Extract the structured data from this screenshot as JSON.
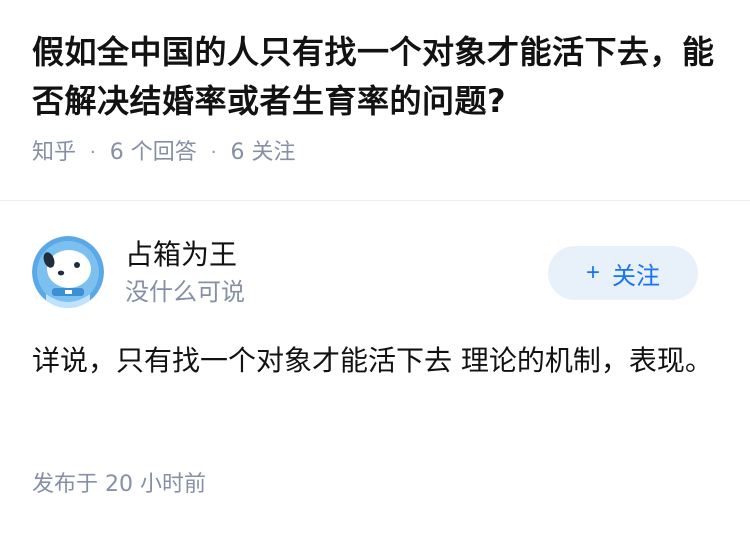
{
  "question": {
    "title": "假如全中国的人只有找一个对象才能活下去，能否解决结婚率或者生育率的问题?",
    "source": "知乎",
    "separator": "·",
    "answers_count": "6 个回答",
    "followers_count": "6 关注"
  },
  "answer": {
    "author_name": "占箱为王",
    "author_bio": "没什么可说",
    "follow_button_icon": "+",
    "follow_button_label": "关注",
    "content": "详说，只有找一个对象才能活下去 理论的机制，表现。",
    "published_time": "发布于  20 小时前"
  },
  "colors": {
    "accent": "#1772f6",
    "follow_bg": "#e8f0fa",
    "meta_text": "#8590a6",
    "primary_text": "#121212",
    "avatar_bg": "#5aa9e6"
  },
  "icons": {
    "avatar": "snow-dog-avatar"
  }
}
